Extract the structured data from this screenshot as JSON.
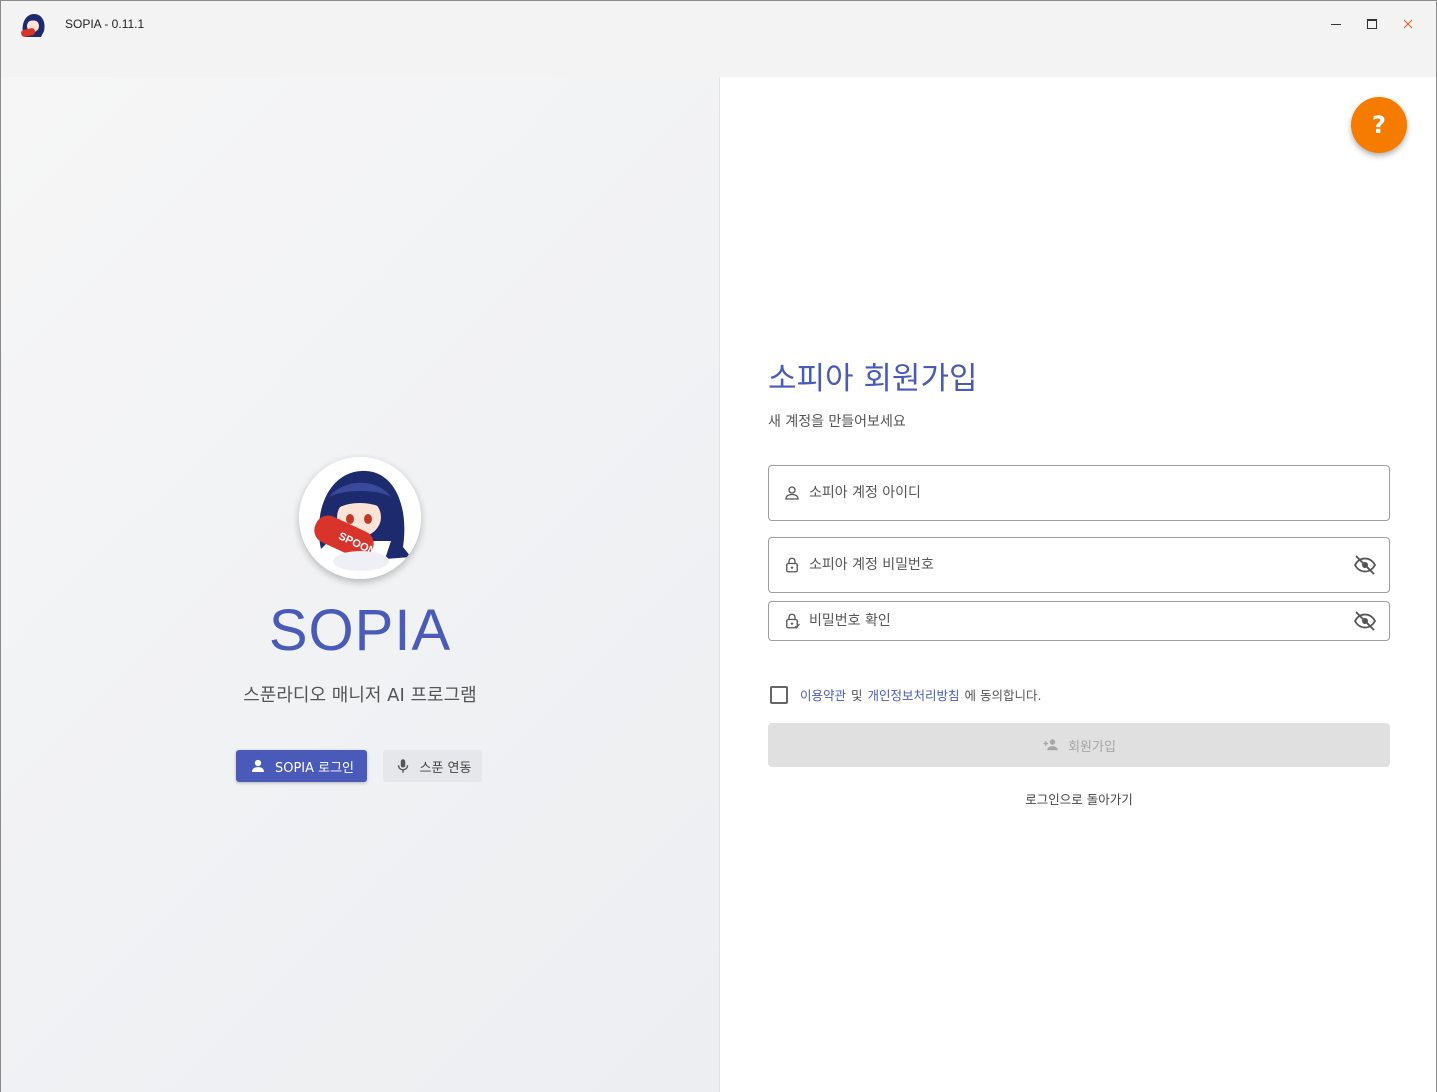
{
  "window": {
    "title": "SOPIA - 0.11.1"
  },
  "left": {
    "brand": "SOPIA",
    "tagline": "스푼라디오 매니저 AI 프로그램",
    "login_button": "SOPIA 로그인",
    "spoon_button": "스푼 연동"
  },
  "form": {
    "title": "소피아 회원가입",
    "subtitle": "새 계정을 만들어보세요",
    "id_placeholder": "소피아 계정 아이디",
    "password_placeholder": "소피아 계정 비밀번호",
    "password_confirm_placeholder": "비밀번호 확인",
    "terms_link": "이용약관",
    "and_text": "및",
    "privacy_link": "개인정보처리방침",
    "agree_text": "에 동의합니다.",
    "signup_button": "회원가입",
    "back_link": "로그인으로 돌아가기",
    "terms_checked": false
  },
  "help": {
    "label": "?"
  },
  "colors": {
    "primary": "#4a5ab8",
    "help_fab": "#f57c00",
    "disabled_button": "#e0e0e0"
  },
  "icons": {
    "app": "sopia-app-icon",
    "user": "person-outline-icon",
    "lock": "lock-outline-icon",
    "lock_check": "lock-check-icon",
    "eye_off": "eye-off-icon",
    "mic": "microphone-icon",
    "add_user": "account-plus-icon"
  }
}
